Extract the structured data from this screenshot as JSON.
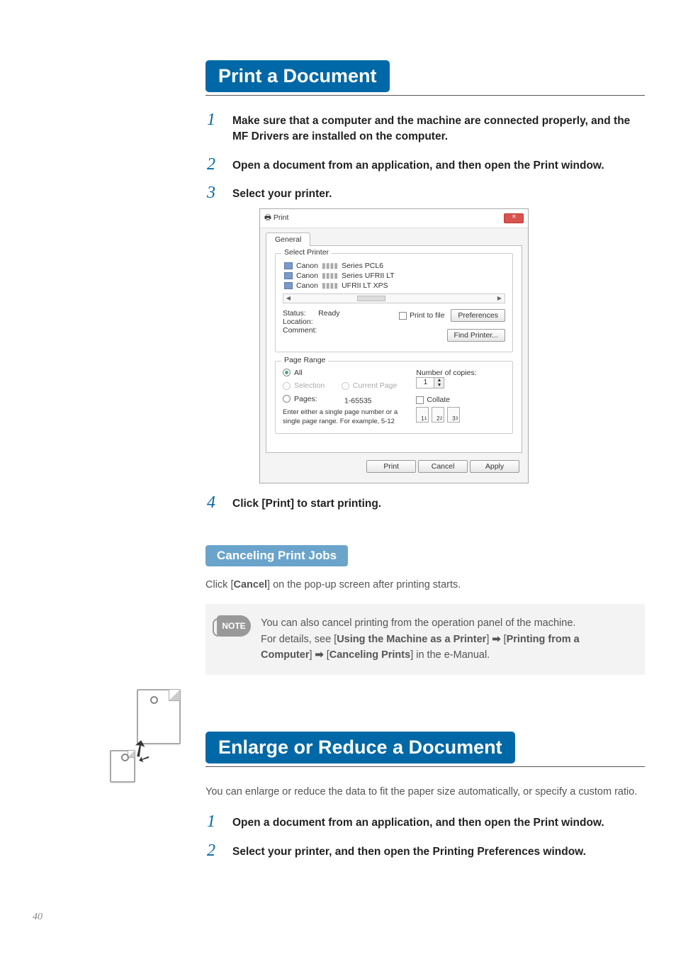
{
  "section1": {
    "title": "Print a Document",
    "step1": "Make sure that a computer and the machine are connected properly, and the MF Drivers are installed on the computer.",
    "step2": "Open a document from an application, and then open the Print window.",
    "step3": "Select your printer.",
    "step4": "Click [Print] to start printing."
  },
  "dlg": {
    "title": "Print",
    "tab": "General",
    "gp_select": "Select Printer",
    "p1": "Canon",
    "p1s": "Series PCL6",
    "p2": "Canon",
    "p2s": "Series UFRII LT",
    "p3": "Canon",
    "p3s": "UFRII LT XPS",
    "status_l": "Status:",
    "status_v": "Ready",
    "location_l": "Location:",
    "comment_l": "Comment:",
    "print_to_file": "Print to file",
    "pref_btn": "Preferences",
    "find_btn": "Find Printer...",
    "gp_range": "Page Range",
    "all": "All",
    "selection": "Selection",
    "current": "Current Page",
    "pages": "Pages:",
    "pages_val": "1-65535",
    "hint": "Enter either a single page number or a single page range.  For example, 5-12",
    "copies_l": "Number of copies:",
    "copies_v": "1",
    "collate": "Collate",
    "m1": "1",
    "m1s": "1",
    "m2": "2",
    "m2s": "2",
    "m3": "3",
    "m3s": "3",
    "print": "Print",
    "cancel": "Cancel",
    "apply": "Apply"
  },
  "sub": {
    "title": "Canceling Print Jobs",
    "body_pre": "Click [",
    "body_cmd": "Cancel",
    "body_post": "] on the pop-up screen after printing starts."
  },
  "note": {
    "badge": "NOTE",
    "line1": "You can also cancel printing from the operation panel of the machine.",
    "line2a": "For details, see [",
    "link1": "Using the Machine as a Printer",
    "line2b": "] ",
    "arrow": "➡",
    "line2c": " [",
    "link2": "Printing from a Computer",
    "line2d": "] ",
    "line2e": " [",
    "link3": "Canceling Prints",
    "line2f": "] in the e-Manual."
  },
  "section2": {
    "title": "Enlarge or Reduce a Document",
    "intro": "You can enlarge or reduce the data to fit the paper size automatically, or specify a custom ratio.",
    "step1": "Open a document from an application, and then open the Print window.",
    "step2": "Select your printer, and then open the Printing Preferences window."
  },
  "page_num": "40"
}
